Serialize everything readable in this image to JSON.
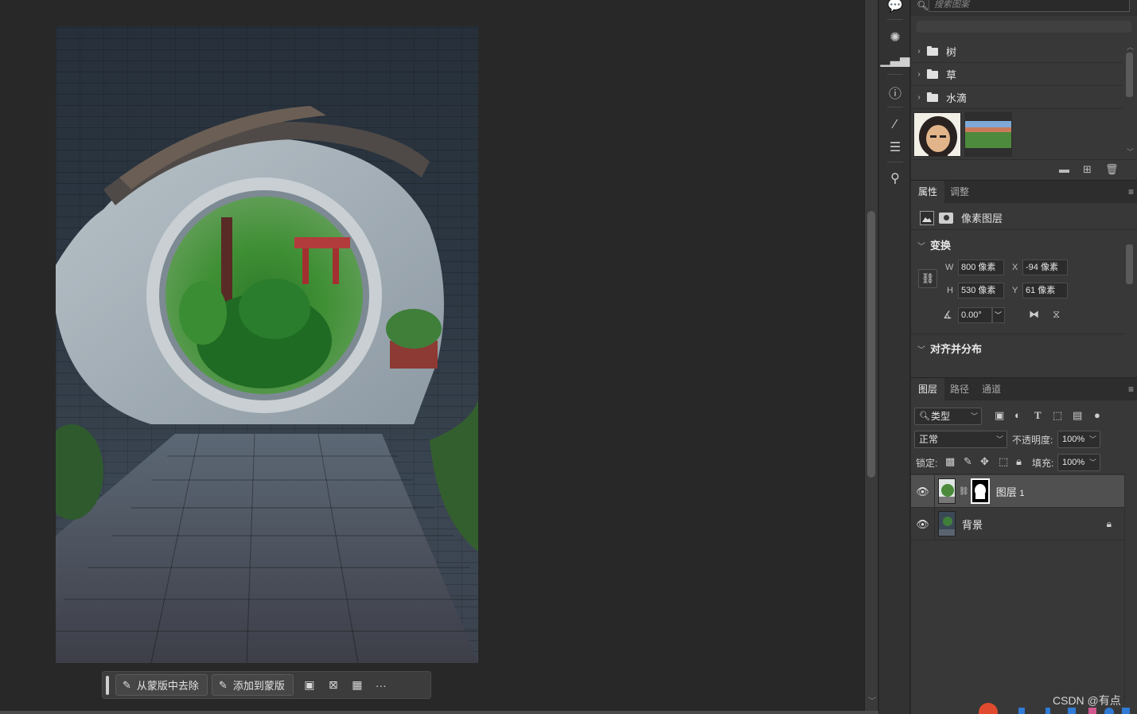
{
  "context_bar": {
    "remove_from_mask": "从蒙版中去除",
    "add_to_mask": "添加到蒙版",
    "more": "···"
  },
  "patterns_panel": {
    "search_placeholder": "搜索图案",
    "folders": [
      "树",
      "草",
      "水滴"
    ]
  },
  "properties_panel": {
    "tabs": [
      "属性",
      "调整"
    ],
    "layer_type": "像素图层",
    "transform": {
      "title": "变换",
      "w_label": "W",
      "w_value": "800 像素",
      "x_label": "X",
      "x_value": "-94 像素",
      "h_label": "H",
      "h_value": "530 像素",
      "y_label": "Y",
      "y_value": "61 像素",
      "angle_value": "0.00°"
    },
    "align_section": "对齐并分布"
  },
  "layers_panel": {
    "tabs": [
      "图层",
      "路径",
      "通道"
    ],
    "filter_kind": "类型",
    "blend_mode": "正常",
    "opacity_label": "不透明度:",
    "opacity_value": "100%",
    "lock_label": "锁定:",
    "fill_label": "填充:",
    "fill_value": "100%",
    "layers": [
      {
        "name": "图层",
        "number": "1",
        "visible": true,
        "selected": true
      },
      {
        "name": "背景",
        "visible": true,
        "locked": true
      }
    ]
  },
  "watermark": "CSDN @有点",
  "colors": {
    "app_bg": "#282828",
    "panel_bg": "#383838",
    "selected_layer": "#505050"
  }
}
